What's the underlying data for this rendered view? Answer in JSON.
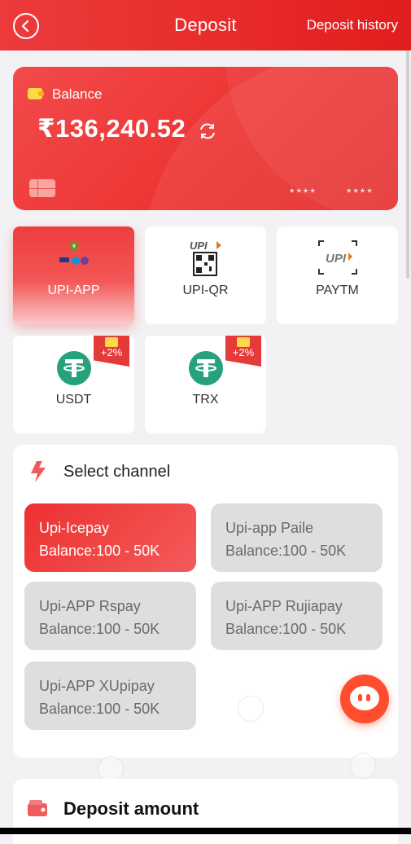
{
  "header": {
    "title": "Deposit",
    "history_link": "Deposit history"
  },
  "balance_card": {
    "label": "Balance",
    "amount": "₹136,240.52",
    "card_mask_1": "****",
    "card_mask_2": "****"
  },
  "payment_methods": [
    {
      "label": "UPI-APP",
      "selected": true
    },
    {
      "label": "UPI-QR",
      "selected": false
    },
    {
      "label": "PAYTM",
      "selected": false
    },
    {
      "label": "USDT",
      "selected": false,
      "bonus": "+2%"
    },
    {
      "label": "TRX",
      "selected": false,
      "bonus": "+2%"
    }
  ],
  "channel_section": {
    "title": "Select channel",
    "channels": [
      {
        "name": "Upi-Icepay",
        "balance": "Balance:100 - 50K",
        "selected": true
      },
      {
        "name": "Upi-app Paile",
        "balance": "Balance:100 - 50K",
        "selected": false
      },
      {
        "name": "Upi-APP Rspay",
        "balance": "Balance:100 - 50K",
        "selected": false
      },
      {
        "name": "Upi-APP Rujiapay",
        "balance": "Balance:100 - 50K",
        "selected": false
      },
      {
        "name": "Upi-APP XUpipay",
        "balance": "Balance:100 - 50K",
        "selected": false
      }
    ]
  },
  "amount_section": {
    "title": "Deposit amount"
  },
  "icons": {
    "back": "back-arrow-icon",
    "refresh": "refresh-icon",
    "bolt": "lightning-icon",
    "chat": "chat-support-icon",
    "wallet": "wallet-icon"
  },
  "colors": {
    "primary": "#e72a2a",
    "tile_bg": "#ffffff",
    "channel_inactive": "#dedede",
    "tether_green": "#26a17b"
  }
}
